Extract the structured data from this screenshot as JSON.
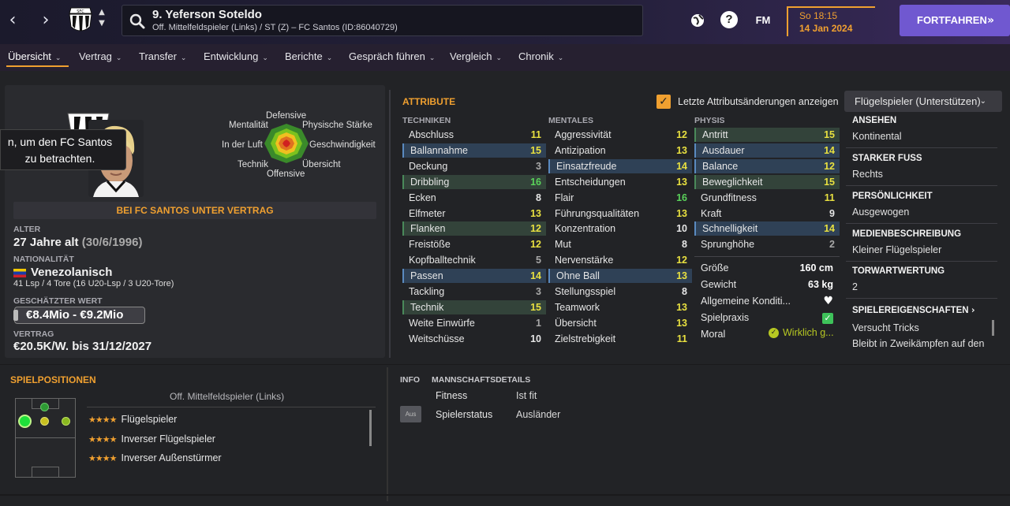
{
  "header": {
    "back_icon": "chevron-left-icon",
    "forward_icon": "chevron-right-icon",
    "player_title": "9. Yeferson Soteldo",
    "player_subtitle": "Off. Mittelfeldspieler (Links) / ST (Z) – FC Santos (ID:86040729)",
    "fm_label": "FM",
    "help_label": "?",
    "time": "So 18:15",
    "date": "14 Jan 2024",
    "continue_label": "FORTFAHREN",
    "accent": "#f0a030",
    "brand": "#7058d0"
  },
  "menu": {
    "items": [
      "Übersicht",
      "Vertrag",
      "Transfer",
      "Entwicklung",
      "Berichte",
      "Gespräch führen",
      "Vergleich",
      "Chronik"
    ]
  },
  "profile": {
    "tooltip": "n, um den FC Santos zu betrachten.",
    "radar_labels": {
      "defensive": "Defensive",
      "mentality": "Mentalität",
      "physical": "Physische Stärke",
      "aerial": "In der Luft",
      "speed": "Geschwindigkeit",
      "technique": "Technik",
      "vision": "Übersicht",
      "offensive": "Offensive"
    },
    "contract_banner": "BEI FC SANTOS UNTER VERTRAG",
    "age_label": "ALTER",
    "age_value": "27 Jahre alt",
    "birthdate": "(30/6/1996)",
    "nationality_label": "NATIONALITÄT",
    "nationality_value": "Venezolanisch",
    "appearances": "41 Lsp / 4 Tore (16 U20-Lsp / 3 U20-Tore)",
    "value_label": "GESCHÄTZTER WERT",
    "value_range": "€8.4Mio - €9.2Mio",
    "contract_label": "VERTRAG",
    "contract_value": "€20.5K/W. bis 31/12/2027"
  },
  "attributes": {
    "title": "ATTRIBUTE",
    "show_changes_label": "Letzte Attributsänderungen anzeigen",
    "show_changes_checked": true,
    "role_select": "Flügelspieler (Unterstützen)",
    "technical_header": "TECHNIKEN",
    "mental_header": "MENTALES",
    "physical_header": "PHYSIS",
    "technical": [
      {
        "name": "Abschluss",
        "value": "11",
        "hl": ""
      },
      {
        "name": "Ballannahme",
        "value": "15",
        "hl": "b"
      },
      {
        "name": "Deckung",
        "value": "3",
        "hl": ""
      },
      {
        "name": "Dribbling",
        "value": "16",
        "hl": "g"
      },
      {
        "name": "Ecken",
        "value": "8",
        "hl": ""
      },
      {
        "name": "Elfmeter",
        "value": "13",
        "hl": ""
      },
      {
        "name": "Flanken",
        "value": "12",
        "hl": "g"
      },
      {
        "name": "Freistöße",
        "value": "12",
        "hl": ""
      },
      {
        "name": "Kopfballtechnik",
        "value": "5",
        "hl": ""
      },
      {
        "name": "Passen",
        "value": "14",
        "hl": "b"
      },
      {
        "name": "Tackling",
        "value": "3",
        "hl": ""
      },
      {
        "name": "Technik",
        "value": "15",
        "hl": "g"
      },
      {
        "name": "Weite Einwürfe",
        "value": "1",
        "hl": ""
      },
      {
        "name": "Weitschüsse",
        "value": "10",
        "hl": ""
      }
    ],
    "mental": [
      {
        "name": "Aggressivität",
        "value": "12",
        "hl": ""
      },
      {
        "name": "Antizipation",
        "value": "13",
        "hl": ""
      },
      {
        "name": "Einsatzfreude",
        "value": "14",
        "hl": "b"
      },
      {
        "name": "Entscheidungen",
        "value": "13",
        "hl": ""
      },
      {
        "name": "Flair",
        "value": "16",
        "hl": ""
      },
      {
        "name": "Führungsqualitäten",
        "value": "13",
        "hl": ""
      },
      {
        "name": "Konzentration",
        "value": "10",
        "hl": ""
      },
      {
        "name": "Mut",
        "value": "8",
        "hl": ""
      },
      {
        "name": "Nervenstärke",
        "value": "12",
        "hl": ""
      },
      {
        "name": "Ohne Ball",
        "value": "13",
        "hl": "b"
      },
      {
        "name": "Stellungsspiel",
        "value": "8",
        "hl": ""
      },
      {
        "name": "Teamwork",
        "value": "13",
        "hl": ""
      },
      {
        "name": "Übersicht",
        "value": "13",
        "hl": ""
      },
      {
        "name": "Zielstrebigkeit",
        "value": "11",
        "hl": ""
      }
    ],
    "physical": [
      {
        "name": "Antritt",
        "value": "15",
        "hl": "g"
      },
      {
        "name": "Ausdauer",
        "value": "14",
        "hl": "b"
      },
      {
        "name": "Balance",
        "value": "12",
        "hl": "b"
      },
      {
        "name": "Beweglichkeit",
        "value": "15",
        "hl": "g"
      },
      {
        "name": "Grundfitness",
        "value": "11",
        "hl": ""
      },
      {
        "name": "Kraft",
        "value": "9",
        "hl": ""
      },
      {
        "name": "Schnelligkeit",
        "value": "14",
        "hl": "b"
      },
      {
        "name": "Sprunghöhe",
        "value": "2",
        "hl": ""
      }
    ],
    "height_label": "Größe",
    "height_value": "160 cm",
    "weight_label": "Gewicht",
    "weight_value": "63 kg",
    "condition_label": "Allgemeine Konditi...",
    "practice_label": "Spielpraxis",
    "morale_label": "Moral",
    "morale_value": "Wirklich g..."
  },
  "right_info": {
    "reputation_label": "ANSEHEN",
    "reputation_value": "Kontinental",
    "foot_label": "STARKER FUSS",
    "foot_value": "Rechts",
    "personality_label": "PERSÖNLICHKEIT",
    "personality_value": "Ausgewogen",
    "media_label": "MEDIENBESCHREIBUNG",
    "media_value": "Kleiner Flügelspieler",
    "gk_label": "TORWARTWERTUNG",
    "gk_value": "2",
    "traits_label": "SPIELEREIGENSCHAFTEN",
    "traits": [
      "Versucht Tricks",
      "Bleibt in Zweikämpfen auf den"
    ]
  },
  "positions": {
    "title": "SPIELPOSITIONEN",
    "current": "Off. Mittelfeldspieler (Links)",
    "roles": [
      {
        "name": "Flügelspieler",
        "stars": 3.5
      },
      {
        "name": "Inverser Flügelspieler",
        "stars": 3.5
      },
      {
        "name": "Inverser Außenstürmer",
        "stars": 3.5
      }
    ]
  },
  "info": {
    "tab_info": "INFO",
    "tab_team": "MANNSCHAFTSDETAILS",
    "fitness_label": "Fitness",
    "fitness_value": "Ist fit",
    "status_badge": "Aus",
    "status_label": "Spielerstatus",
    "status_value": "Ausländer"
  }
}
